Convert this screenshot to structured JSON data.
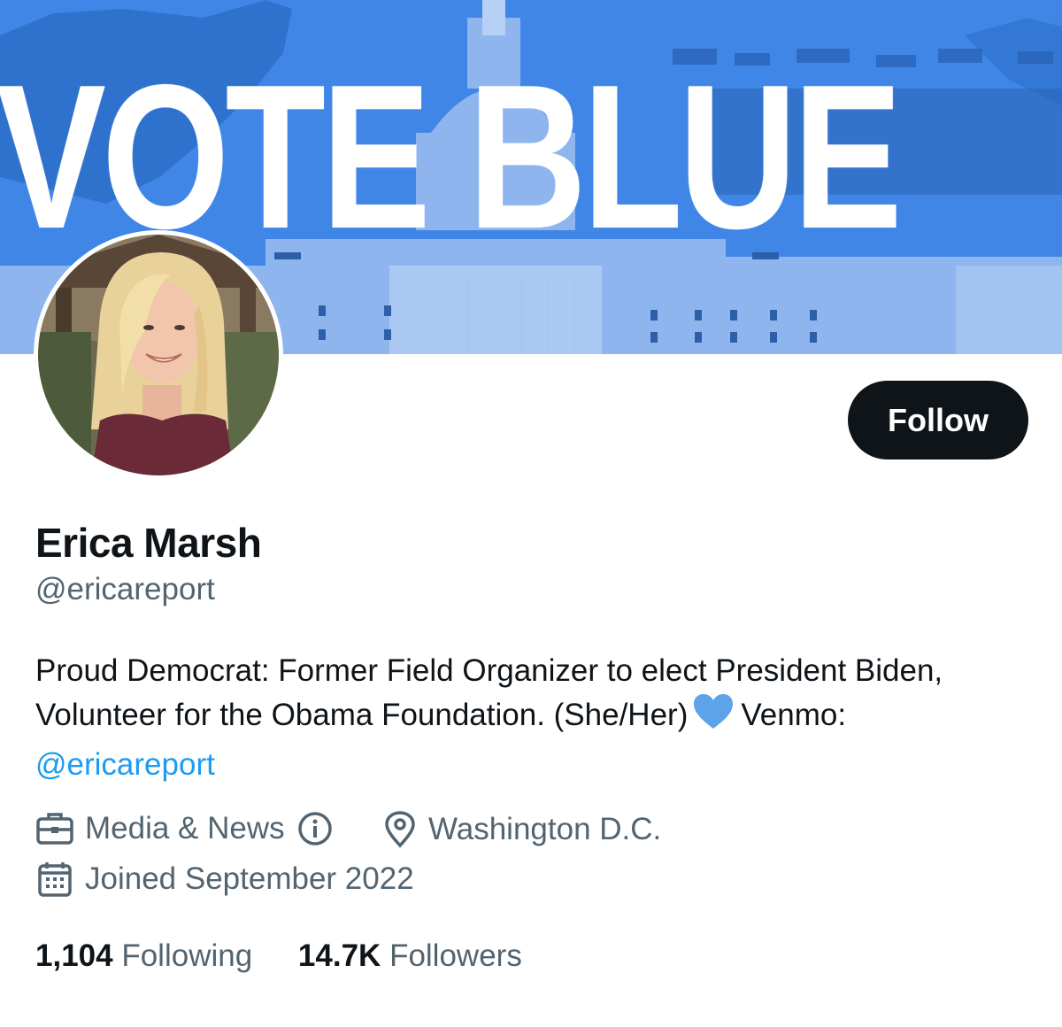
{
  "banner": {
    "text": "VOTE BLUE"
  },
  "profile": {
    "name": "Erica Marsh",
    "handle": "@ericareport",
    "follow_label": "Follow",
    "bio": {
      "line1": "Proud Democrat: Former Field Organizer to elect President Biden,",
      "line2_a": "Volunteer for the Obama Foundation. (She/Her)",
      "line2_b": "Venmo:",
      "link": "@ericareport"
    },
    "category": "Media & News",
    "location": "Washington D.C.",
    "joined": "Joined September 2022",
    "following_count": "1,104",
    "following_label": "Following",
    "followers_count": "14.7K",
    "followers_label": "Followers"
  },
  "colors": {
    "banner_blue": "#3f86e6",
    "link_blue": "#1d9bf0",
    "heart_blue": "#5da3e8",
    "secondary_text": "#536471",
    "primary_text": "#0f1419"
  },
  "icons": [
    "briefcase-icon",
    "info-icon",
    "location-pin-icon",
    "calendar-icon",
    "blue-heart-icon"
  ]
}
